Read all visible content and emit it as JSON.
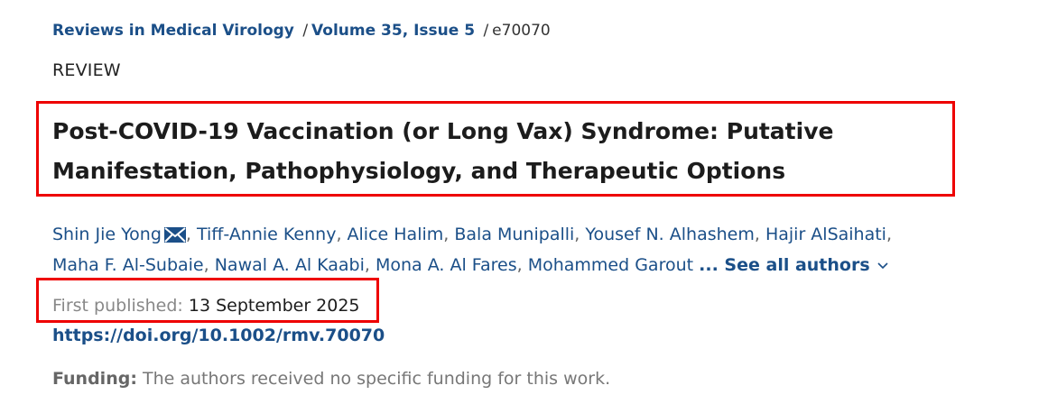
{
  "breadcrumb": {
    "journal": "Reviews in Medical Virology",
    "separator_1": "/",
    "issue": "Volume 35, Issue 5",
    "separator_2": "/",
    "article_id": "e70070"
  },
  "article_type": "REVIEW",
  "title": "Post-COVID-19 Vaccination (or Long Vax) Syndrome: Putative Manifestation, Pathophysiology, and Therapeutic Options",
  "authors": {
    "list": [
      "Shin Jie Yong",
      "Tiff-Annie Kenny",
      "Alice Halim",
      "Bala Munipalli",
      "Yousef N. Alhashem",
      "Hajir AlSaihati",
      "Maha F. Al-Subaie",
      "Nawal A. Al Kaabi",
      "Mona A. Al Fares",
      "Mohammed Garout"
    ],
    "separator": ",",
    "ellipsis": "...",
    "see_all_label": "See all authors",
    "corresponding_icon": "envelope-icon",
    "see_all_icon": "chevron-down-icon"
  },
  "publication": {
    "label": "First published:",
    "date": "13 September 2025"
  },
  "doi": "https://doi.org/10.1002/rmv.70070",
  "funding": {
    "label": "Funding:",
    "text": "The authors received no specific funding for this work."
  },
  "colors": {
    "link": "#1b4f88",
    "highlight_box": "#ee0000",
    "text": "#1c1c1c",
    "muted": "#888888"
  }
}
